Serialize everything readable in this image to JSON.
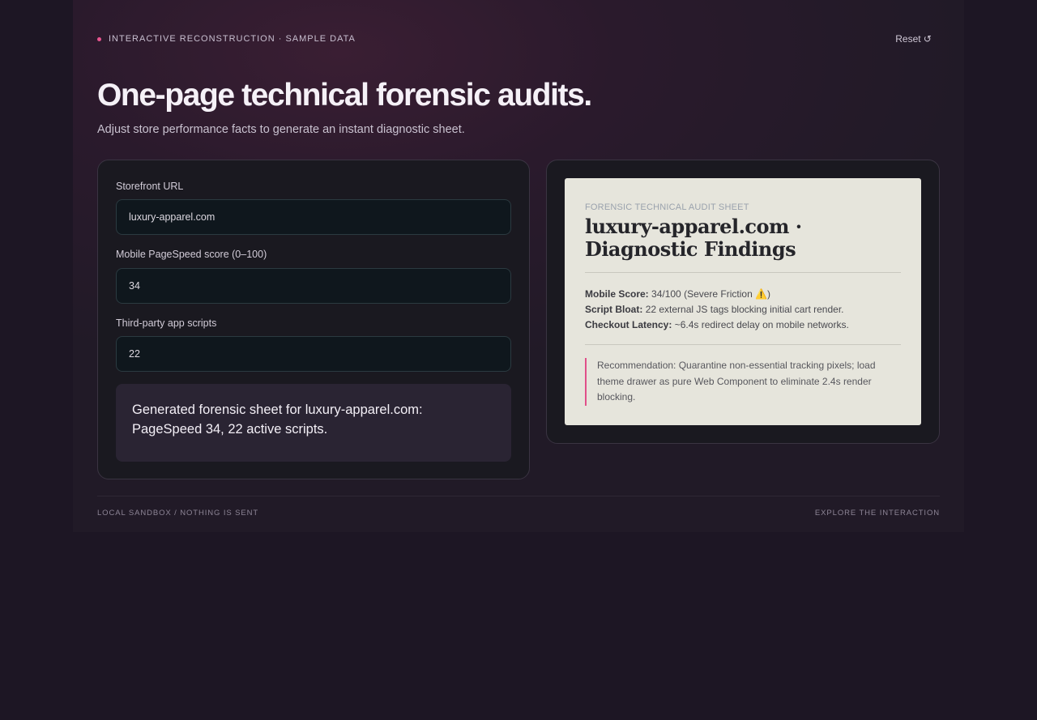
{
  "header": {
    "kicker": "INTERACTIVE RECONSTRUCTION · SAMPLE DATA",
    "reset_label": "Reset ↺",
    "title": "One-page technical forensic audits.",
    "subtitle": "Adjust store performance facts to generate an instant diagnostic sheet."
  },
  "form": {
    "url_label": "Storefront URL",
    "url_value": "luxury-apparel.com",
    "score_label": "Mobile PageSpeed score (0–100)",
    "score_value": "34",
    "scripts_label": "Third-party app scripts",
    "scripts_value": "22",
    "summary": "Generated forensic sheet for luxury-apparel.com: PageSpeed 34, 22 active scripts."
  },
  "sheet": {
    "kicker": "FORENSIC TECHNICAL AUDIT SHEET",
    "title": "luxury-apparel.com · Diagnostic Findings",
    "findings": [
      {
        "label": "Mobile Score:",
        "text": "34/100 (Severe Friction ⚠️)"
      },
      {
        "label": "Script Bloat:",
        "text": "22 external JS tags blocking initial cart render."
      },
      {
        "label": "Checkout Latency:",
        "text": "~6.4s redirect delay on mobile networks."
      }
    ],
    "recommendation": "Recommendation: Quarantine non-essential tracking pixels; load theme drawer as pure Web Component to eliminate 2.4s render blocking."
  },
  "footer": {
    "left": "LOCAL SANDBOX / NOTHING IS SENT",
    "right": "EXPLORE THE INTERACTION"
  },
  "colors": {
    "accent": "#e8558f",
    "background": "#1d1624",
    "sheet_paper": "#e6e5dc"
  }
}
